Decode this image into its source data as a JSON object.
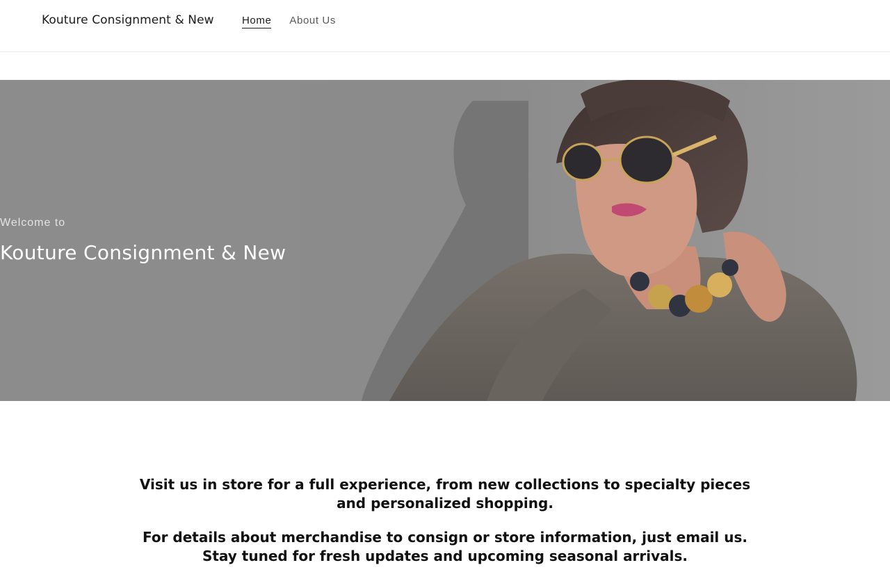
{
  "header": {
    "brand": "Kouture Consignment & New",
    "nav": [
      {
        "label": "Home",
        "active": true
      },
      {
        "label": "About Us",
        "active": false
      }
    ]
  },
  "hero": {
    "eyebrow": "Welcome to",
    "title": "Kouture Consignment & New",
    "overlay_color": "#8a8a8a"
  },
  "body": {
    "paragraph_1": "Visit us in store for a full experience, from new collections to specialty pieces and personalized shopping.",
    "paragraph_2": "For details about merchandise to consign or store information, just email us. Stay tuned for fresh updates and upcoming seasonal arrivals."
  }
}
